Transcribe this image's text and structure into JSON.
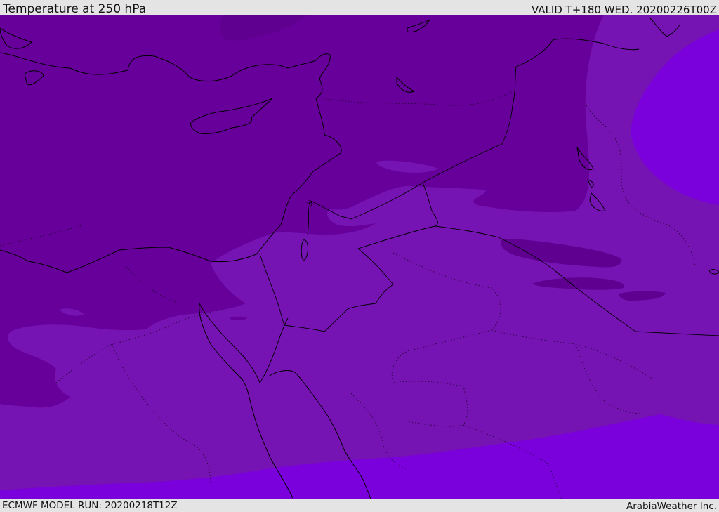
{
  "header": {
    "title": "Temperature at 250 hPa",
    "valid": "VALID T+180 WED. 20200226T00Z"
  },
  "footer": {
    "model_run": "ECMWF MODEL RUN: 20200218T12Z",
    "credit": "ArabiaWeather Inc."
  },
  "map": {
    "field": "temperature",
    "level": "250 hPa",
    "colors": {
      "darkest": "#5f0090",
      "dark": "#67009a",
      "mid": "#7613b3",
      "light": "#7a00dc",
      "coast": "#000000"
    }
  }
}
